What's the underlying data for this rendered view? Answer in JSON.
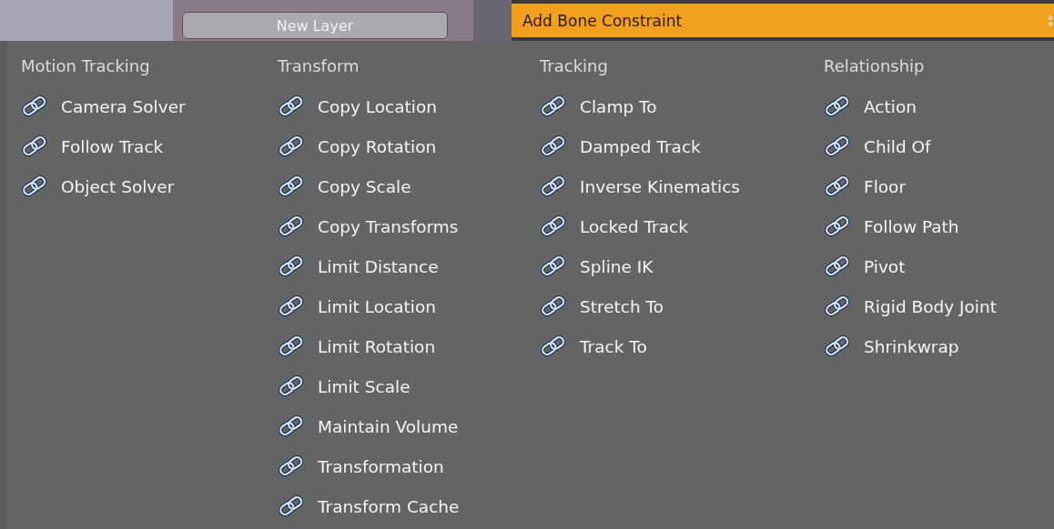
{
  "background": {
    "button": {
      "label": "New Layer"
    }
  },
  "header": {
    "title": "Add Bone Constraint"
  },
  "menu": {
    "columns": [
      {
        "heading": "Motion Tracking",
        "items": [
          {
            "label": "Camera Solver"
          },
          {
            "label": "Follow Track"
          },
          {
            "label": "Object Solver"
          }
        ]
      },
      {
        "heading": "Transform",
        "items": [
          {
            "label": "Copy Location"
          },
          {
            "label": "Copy Rotation"
          },
          {
            "label": "Copy Scale"
          },
          {
            "label": "Copy Transforms"
          },
          {
            "label": "Limit Distance"
          },
          {
            "label": "Limit Location"
          },
          {
            "label": "Limit Rotation"
          },
          {
            "label": "Limit Scale"
          },
          {
            "label": "Maintain Volume"
          },
          {
            "label": "Transformation"
          },
          {
            "label": "Transform Cache"
          }
        ]
      },
      {
        "heading": "Tracking",
        "items": [
          {
            "label": "Clamp To"
          },
          {
            "label": "Damped Track"
          },
          {
            "label": "Inverse Kinematics"
          },
          {
            "label": "Locked Track"
          },
          {
            "label": "Spline IK"
          },
          {
            "label": "Stretch To"
          },
          {
            "label": "Track To"
          }
        ]
      },
      {
        "heading": "Relationship",
        "items": [
          {
            "label": "Action"
          },
          {
            "label": "Child Of"
          },
          {
            "label": "Floor"
          },
          {
            "label": "Follow Path"
          },
          {
            "label": "Pivot"
          },
          {
            "label": "Rigid Body Joint"
          },
          {
            "label": "Shrinkwrap"
          }
        ]
      }
    ]
  }
}
